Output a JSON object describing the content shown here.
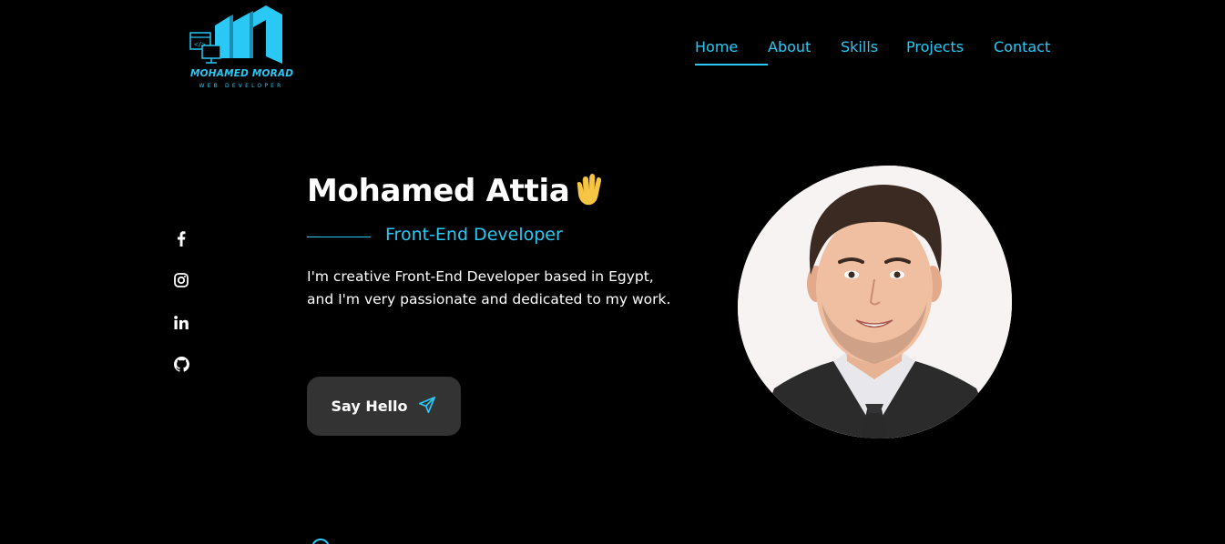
{
  "brand": {
    "name": "MOHAMED MORAD",
    "tagline": "WEB DEVELOPER",
    "accent": "#29c8f5"
  },
  "nav": {
    "items": [
      {
        "label": "Home",
        "active": true
      },
      {
        "label": "About",
        "active": false
      },
      {
        "label": "Skills",
        "active": false
      },
      {
        "label": "Projects",
        "active": false
      },
      {
        "label": "Contact",
        "active": false
      }
    ]
  },
  "social": {
    "icons": [
      "facebook-icon",
      "instagram-icon",
      "linkedin-icon",
      "github-icon"
    ]
  },
  "hero": {
    "name": "Mohamed Attia",
    "wave_icon": "waving-hand-icon",
    "title": "Front-End Developer",
    "description": "I'm creative Front-End Developer based in Egypt, and I'm very passionate and dedicated to my work.",
    "cta_label": "Say Hello",
    "cta_icon": "send-icon"
  },
  "colors": {
    "background": "#000000",
    "accent": "#29c8f5",
    "button_bg": "#333333"
  }
}
